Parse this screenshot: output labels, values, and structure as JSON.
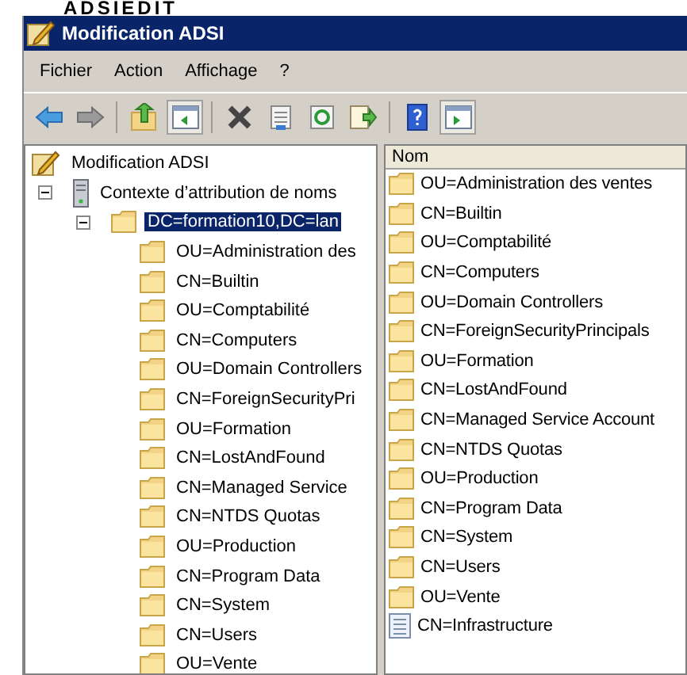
{
  "heading": "ADSIEDIT",
  "window": {
    "title": "Modification ADSI"
  },
  "menu": [
    "Fichier",
    "Action",
    "Affichage",
    "?"
  ],
  "toolbar": [
    {
      "kind": "back",
      "pressed": false
    },
    {
      "kind": "forward",
      "pressed": false
    },
    {
      "kind": "sep"
    },
    {
      "kind": "up",
      "pressed": false
    },
    {
      "kind": "tree",
      "pressed": true
    },
    {
      "kind": "sep"
    },
    {
      "kind": "delete",
      "pressed": false
    },
    {
      "kind": "properties",
      "pressed": false
    },
    {
      "kind": "refresh",
      "pressed": false
    },
    {
      "kind": "export",
      "pressed": false
    },
    {
      "kind": "sep"
    },
    {
      "kind": "help",
      "pressed": false
    },
    {
      "kind": "actionpane",
      "pressed": true
    }
  ],
  "tree": [
    {
      "label": "Modification ADSI",
      "kind": "snapin",
      "selected": false,
      "children": [
        {
          "label": "Contexte d’attribution de noms",
          "kind": "server",
          "expanded": true,
          "selected": false,
          "children": [
            {
              "label": "DC=formation10,DC=lan",
              "kind": "folder",
              "expanded": true,
              "selected": true,
              "children": [
                {
                  "label": "OU=Administration des",
                  "kind": "folder",
                  "selected": false
                },
                {
                  "label": "CN=Builtin",
                  "kind": "folder",
                  "selected": false
                },
                {
                  "label": "OU=Comptabilité",
                  "kind": "folder",
                  "selected": false
                },
                {
                  "label": "CN=Computers",
                  "kind": "folder",
                  "selected": false
                },
                {
                  "label": "OU=Domain Controllers",
                  "kind": "folder",
                  "selected": false
                },
                {
                  "label": "CN=ForeignSecurityPri",
                  "kind": "folder",
                  "selected": false
                },
                {
                  "label": "OU=Formation",
                  "kind": "folder",
                  "selected": false
                },
                {
                  "label": "CN=LostAndFound",
                  "kind": "folder",
                  "selected": false
                },
                {
                  "label": "CN=Managed Service",
                  "kind": "folder",
                  "selected": false
                },
                {
                  "label": "CN=NTDS Quotas",
                  "kind": "folder",
                  "selected": false
                },
                {
                  "label": "OU=Production",
                  "kind": "folder",
                  "selected": false
                },
                {
                  "label": "CN=Program Data",
                  "kind": "folder",
                  "selected": false
                },
                {
                  "label": "CN=System",
                  "kind": "folder",
                  "selected": false
                },
                {
                  "label": "CN=Users",
                  "kind": "folder",
                  "selected": false
                },
                {
                  "label": "OU=Vente",
                  "kind": "folder",
                  "selected": false
                }
              ]
            }
          ]
        }
      ]
    }
  ],
  "list": {
    "columns": [
      "Nom"
    ],
    "rows": [
      {
        "name": "OU=Administration des ventes",
        "kind": "folder"
      },
      {
        "name": "CN=Builtin",
        "kind": "folder"
      },
      {
        "name": "OU=Comptabilité",
        "kind": "folder"
      },
      {
        "name": "CN=Computers",
        "kind": "folder"
      },
      {
        "name": "OU=Domain Controllers",
        "kind": "folder"
      },
      {
        "name": "CN=ForeignSecurityPrincipals",
        "kind": "folder"
      },
      {
        "name": "OU=Formation",
        "kind": "folder"
      },
      {
        "name": "CN=LostAndFound",
        "kind": "folder"
      },
      {
        "name": "CN=Managed Service Account",
        "kind": "folder"
      },
      {
        "name": "CN=NTDS Quotas",
        "kind": "folder"
      },
      {
        "name": "OU=Production",
        "kind": "folder"
      },
      {
        "name": "CN=Program Data",
        "kind": "folder"
      },
      {
        "name": "CN=System",
        "kind": "folder"
      },
      {
        "name": "CN=Users",
        "kind": "folder"
      },
      {
        "name": "OU=Vente",
        "kind": "folder"
      },
      {
        "name": "CN=Infrastructure",
        "kind": "document"
      }
    ]
  }
}
